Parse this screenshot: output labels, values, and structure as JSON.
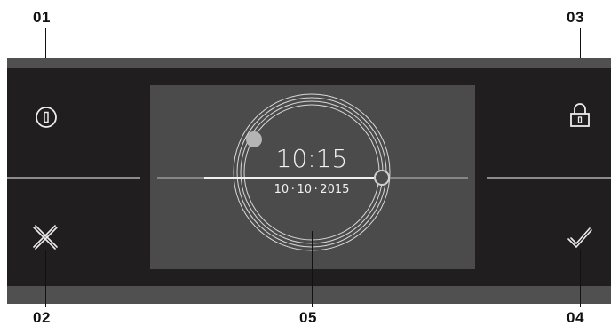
{
  "callouts": {
    "c01": "01",
    "c02": "02",
    "c03": "03",
    "c04": "04",
    "c05": "05"
  },
  "display": {
    "time": "10:15",
    "date": "10 · 10 · 2015"
  },
  "icons": {
    "top_left": "power-icon",
    "bottom_left": "cancel-x-icon",
    "top_right": "lock-icon",
    "bottom_right": "checkmark-icon"
  },
  "colors": {
    "panel": "#201e1f",
    "panel_border": "#505050",
    "screen": "#4b4b4b",
    "ring": "#d8d8d8",
    "icon_stroke": "#ececec",
    "knob_fill": "#b4b4b4"
  }
}
